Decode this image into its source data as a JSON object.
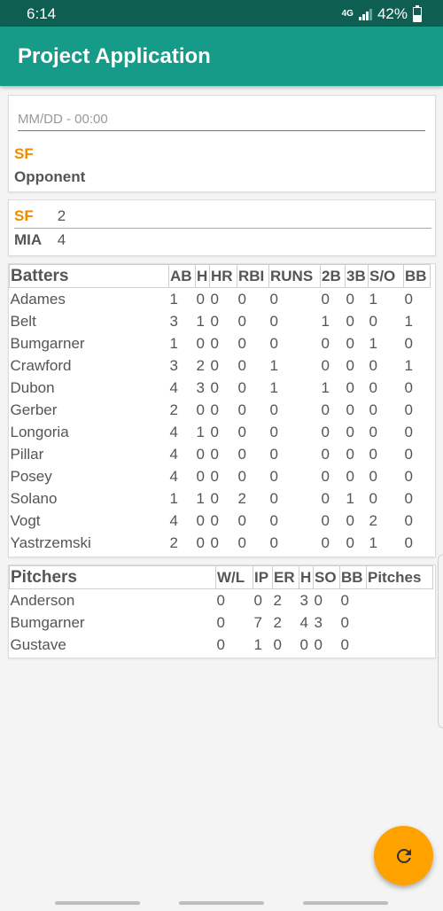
{
  "status_bar": {
    "time": "6:14",
    "network": "4G",
    "battery": "42%"
  },
  "app_bar": {
    "title": "Project Application"
  },
  "game": {
    "date_placeholder": "MM/DD - 00:00",
    "team": "SF",
    "opponent_label": "Opponent"
  },
  "score": {
    "home": {
      "abbr": "SF",
      "runs": "2"
    },
    "away": {
      "abbr": "MIA",
      "runs": "4"
    }
  },
  "batters": {
    "headers": [
      "Batters",
      "AB",
      "H",
      "HR",
      "RBI",
      "RUNS",
      "2B",
      "3B",
      "S/O",
      "BB"
    ],
    "rows": [
      [
        "Adames",
        "1",
        "0",
        "0",
        "0",
        "0",
        "0",
        "0",
        "1",
        "0"
      ],
      [
        "Belt",
        "3",
        "1",
        "0",
        "0",
        "0",
        "1",
        "0",
        "0",
        "1"
      ],
      [
        "Bumgarner",
        "1",
        "0",
        "0",
        "0",
        "0",
        "0",
        "0",
        "1",
        "0"
      ],
      [
        "Crawford",
        "3",
        "2",
        "0",
        "0",
        "1",
        "0",
        "0",
        "0",
        "1"
      ],
      [
        "Dubon",
        "4",
        "3",
        "0",
        "0",
        "1",
        "1",
        "0",
        "0",
        "0"
      ],
      [
        "Gerber",
        "2",
        "0",
        "0",
        "0",
        "0",
        "0",
        "0",
        "0",
        "0"
      ],
      [
        "Longoria",
        "4",
        "1",
        "0",
        "0",
        "0",
        "0",
        "0",
        "0",
        "0"
      ],
      [
        "Pillar",
        "4",
        "0",
        "0",
        "0",
        "0",
        "0",
        "0",
        "0",
        "0"
      ],
      [
        "Posey",
        "4",
        "0",
        "0",
        "0",
        "0",
        "0",
        "0",
        "0",
        "0"
      ],
      [
        "Solano",
        "1",
        "1",
        "0",
        "2",
        "0",
        "0",
        "1",
        "0",
        "0"
      ],
      [
        "Vogt",
        "4",
        "0",
        "0",
        "0",
        "0",
        "0",
        "0",
        "2",
        "0"
      ],
      [
        "Yastrzemski",
        "2",
        "0",
        "0",
        "0",
        "0",
        "0",
        "0",
        "1",
        "0"
      ]
    ]
  },
  "pitchers": {
    "headers": [
      "Pitchers",
      "W/L",
      "IP",
      "ER",
      "H",
      "SO",
      "BB",
      "Pitches"
    ],
    "rows": [
      [
        "Anderson",
        "0",
        "0",
        "2",
        "3",
        "0",
        "0",
        ""
      ],
      [
        "Bumgarner",
        "0",
        "7",
        "2",
        "4",
        "3",
        "0",
        ""
      ],
      [
        "Gustave",
        "0",
        "1",
        "0",
        "0",
        "0",
        "0",
        ""
      ]
    ]
  },
  "fab": {
    "icon": "refresh-icon"
  },
  "colors": {
    "app_bar": "#159b88",
    "status_bar": "#0e5e52",
    "accent": "#ffa200",
    "team": "#f08a00"
  }
}
